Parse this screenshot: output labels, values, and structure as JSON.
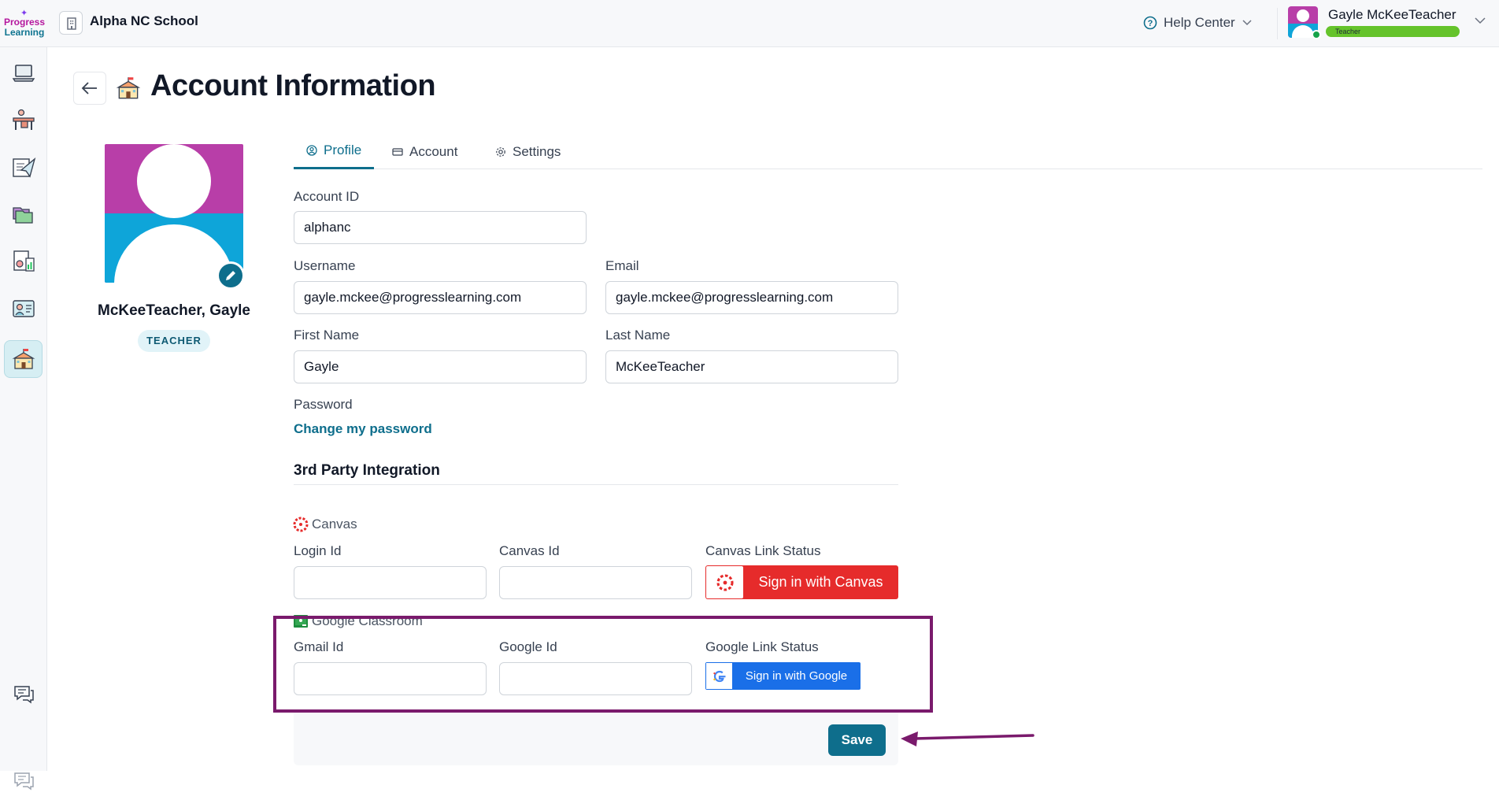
{
  "header": {
    "logo_line1": "Progress",
    "logo_line2": "Learning",
    "school_name": "Alpha NC School",
    "help_label": "Help Center",
    "user_name": "Gayle McKeeTeacher",
    "user_role": "Teacher"
  },
  "sidebar": {
    "items": [
      {
        "icon": "laptop-icon"
      },
      {
        "icon": "classroom-desk-icon"
      },
      {
        "icon": "assignment-send-icon"
      },
      {
        "icon": "folders-icon"
      },
      {
        "icon": "reports-icon"
      },
      {
        "icon": "gradebook-icon"
      },
      {
        "icon": "school-icon",
        "active": true
      }
    ],
    "bottom_items": [
      {
        "icon": "chat-icon"
      },
      {
        "icon": "chat-disabled-icon"
      }
    ]
  },
  "page": {
    "title": "Account Information"
  },
  "profile": {
    "name": "McKeeTeacher, Gayle",
    "badge": "TEACHER"
  },
  "tabs": [
    {
      "label": "Profile",
      "active": true
    },
    {
      "label": "Account"
    },
    {
      "label": "Settings"
    }
  ],
  "form": {
    "account_id_label": "Account ID",
    "account_id_value": "alphanc",
    "username_label": "Username",
    "username_value": "gayle.mckee@progresslearning.com",
    "email_label": "Email",
    "email_value": "gayle.mckee@progresslearning.com",
    "first_name_label": "First Name",
    "first_name_value": "Gayle",
    "last_name_label": "Last Name",
    "last_name_value": "McKeeTeacher",
    "password_label": "Password",
    "change_password_link": "Change my password"
  },
  "integration": {
    "section_title": "3rd Party Integration",
    "canvas": {
      "name": "Canvas",
      "login_id_label": "Login Id",
      "login_id_value": "",
      "canvas_id_label": "Canvas Id",
      "canvas_id_value": "",
      "status_label": "Canvas Link Status",
      "button_label": "Sign in with Canvas",
      "brand_color": "#e62b2b"
    },
    "google": {
      "name": "Google Classroom",
      "gmail_id_label": "Gmail Id",
      "gmail_id_value": "",
      "google_id_label": "Google Id",
      "google_id_value": "",
      "status_label": "Google Link Status",
      "button_label": "Sign in with Google",
      "brand_color": "#1a6fe8"
    }
  },
  "actions": {
    "save_label": "Save"
  },
  "colors": {
    "accent": "#0e6e8c",
    "annotation": "#7a1a6c"
  }
}
